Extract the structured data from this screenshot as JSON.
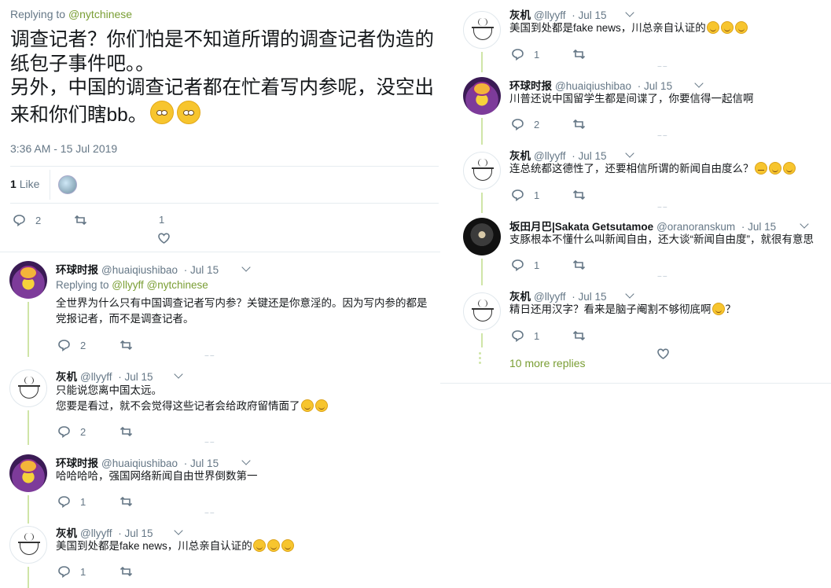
{
  "main_tweet": {
    "replying_prefix": "Replying to ",
    "replying_to": "@nytchinese",
    "text_line1": "调查记者？你们怕是不知道所谓的调查记者伪造的纸包子事件吧。。",
    "text_line2": "另外，中国的调查记者都在忙着写内参呢，没空出来和你们瞎bb。",
    "timestamp": "3:36 AM - 15 Jul 2019",
    "likes_count": "1",
    "likes_label": "Like",
    "reply_count": "2",
    "like_count_action": "1"
  },
  "left_replies": [
    {
      "name": "环球时报",
      "handle": "@huaiqiushibao",
      "date": "Jul 15",
      "replying_prefix": "Replying to ",
      "replying_to_1": "@llyyff",
      "replying_to_2": "@nytchinese",
      "text_line1": "全世界为什么只有中国调查记者写内参？关键还是你意淫的。因为写内参的都是",
      "text_line2": "党报记者，而不是调查记者。",
      "reply_count": "2"
    },
    {
      "name": "灰机",
      "handle": "@llyyff",
      "date": "Jul 15",
      "text_line1": "只能说您离中国太远。",
      "text_line2": "您要是看过，就不会觉得这些记者会给政府留情面了",
      "reply_count": "2"
    },
    {
      "name": "环球时报",
      "handle": "@huaiqiushibao",
      "date": "Jul 15",
      "text_line1": "哈哈哈哈，强国网络新闻自由世界倒数第一",
      "reply_count": "1"
    },
    {
      "name": "灰机",
      "handle": "@llyyff",
      "date": "Jul 15",
      "text_line1": "美国到处都是fake news，川总亲自认证的",
      "reply_count": "1"
    }
  ],
  "right_replies": [
    {
      "name": "灰机",
      "handle": "@llyyff",
      "date": "Jul 15",
      "text_line1": "美国到处都是fake news，川总亲自认证的",
      "reply_count": "1"
    },
    {
      "name": "环球时报",
      "handle": "@huaiqiushibao",
      "date": "Jul 15",
      "text_line1": "川普还说中国留学生都是间谍了，你要信得一起信啊",
      "reply_count": "2"
    },
    {
      "name": "灰机",
      "handle": "@llyyff",
      "date": "Jul 15",
      "text_line1": "连总统都这德性了，还要相信所谓的新闻自由度么？",
      "reply_count": "1"
    },
    {
      "name": "坂田月巴|Sakata Getsutamoe",
      "handle": "@oranoranskum",
      "date": "Jul 15",
      "text_line1": "支豚根本不懂什么叫新闻自由，还大谈“新闻自由度”，就很有意思",
      "reply_count": "1"
    },
    {
      "name": "灰机",
      "handle": "@llyyff",
      "date": "Jul 15",
      "text_line1": "精日还用汉字？看来是脑子阉割不够彻底啊",
      "text_suffix": "？",
      "reply_count": "1"
    }
  ],
  "more_replies": "10 more replies",
  "colors": {
    "link": "#7a9e34",
    "muted": "#657786",
    "thread": "#cfe5a7"
  },
  "icons": [
    "reply-icon",
    "retweet-icon",
    "heart-icon",
    "chevron-down-icon",
    "emoji-icon"
  ]
}
